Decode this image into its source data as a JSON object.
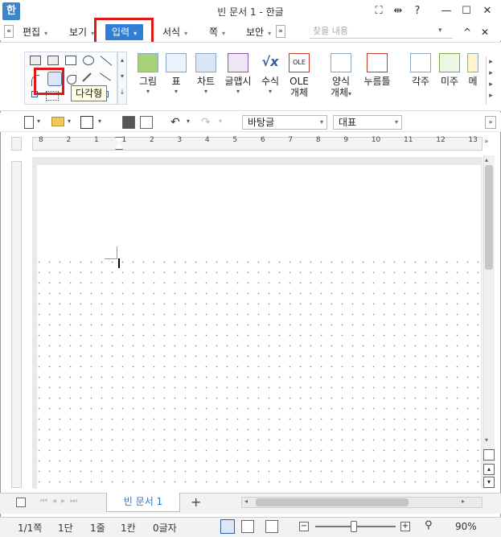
{
  "window": {
    "title": "빈 문서 1 - 한글",
    "app_icon_label": "한",
    "controls": {
      "fullscreen": "⛶",
      "split": "⇹",
      "help": "?",
      "minimize": "—",
      "maximize": "☐",
      "close": "✕"
    }
  },
  "menubar": {
    "nav_left": "«",
    "items": [
      {
        "label": "편집"
      },
      {
        "label": "보기"
      },
      {
        "label": "입력",
        "active": true
      },
      {
        "label": "서식"
      },
      {
        "label": "쪽"
      },
      {
        "label": "보안"
      }
    ],
    "nav_right": "»",
    "find_placeholder": "찾을 내용",
    "collapse_icon": "^",
    "close_icon": "✕"
  },
  "ribbon": {
    "buttons": [
      {
        "label": "그림",
        "icon": "picture-icon",
        "dropdown": true
      },
      {
        "label": "표",
        "icon": "table-icon",
        "dropdown": true
      },
      {
        "label": "차트",
        "icon": "chart-icon",
        "dropdown": true
      },
      {
        "label": "글맵시",
        "icon": "wordart-icon",
        "dropdown": true
      },
      {
        "label": "수식",
        "icon": "formula-icon",
        "dropdown": true
      },
      {
        "label": "OLE",
        "label2": "개체",
        "icon": "ole-icon"
      },
      {
        "label": "양식",
        "label2": "개체",
        "icon": "form-icon",
        "dropdown": true
      },
      {
        "label": "누름틀",
        "icon": "field-icon"
      },
      {
        "label": "각주",
        "icon": "footnote-icon"
      },
      {
        "label": "미주",
        "icon": "endnote-icon"
      },
      {
        "label": "메",
        "icon": "memo-icon"
      }
    ],
    "tooltip": "다각형"
  },
  "toolbar": {
    "style_select": "바탕글",
    "font_select": "대표"
  },
  "ruler": {
    "ticks": [
      "8",
      "2",
      "1",
      "1",
      "2",
      "3",
      "4",
      "5",
      "6",
      "7",
      "8",
      "9",
      "10",
      "11",
      "12",
      "13"
    ]
  },
  "tabs": {
    "document_tab": "빈 문서 1",
    "add_tab": "+"
  },
  "status": {
    "page": "1/1쪽",
    "column": "1단",
    "line": "1줄",
    "col": "1칸",
    "chars": "0글자",
    "zoom": "90%"
  },
  "colors": {
    "accent": "#2f7fd6",
    "highlight_box": "#e01818"
  }
}
